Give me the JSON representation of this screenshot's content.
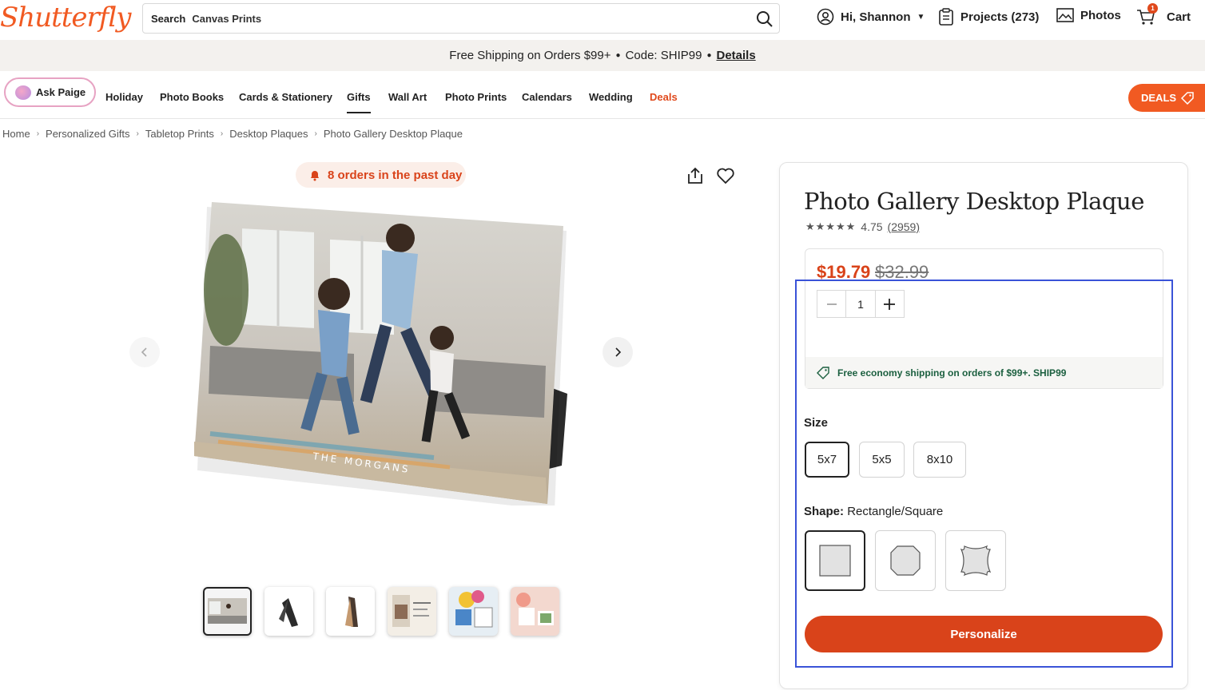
{
  "header": {
    "logo": "Shutterfly",
    "search_label": "Search",
    "search_value": "Canvas Prints",
    "greeting": "Hi, Shannon",
    "projects": "Projects (273)",
    "photos": "Photos",
    "cart": "Cart",
    "cart_badge": "1"
  },
  "promo": {
    "text": "Free Shipping on Orders $99+",
    "code": "Code: SHIP99",
    "details": "Details"
  },
  "nav": {
    "ask": "Ask Paige",
    "items": [
      "Holiday",
      "Photo Books",
      "Cards & Stationery",
      "Gifts",
      "Wall Art",
      "Photo Prints",
      "Calendars",
      "Wedding",
      "Deals"
    ],
    "deals_button": "DEALS"
  },
  "breadcrumb": [
    "Home",
    "Personalized Gifts",
    "Tabletop Prints",
    "Desktop Plaques",
    "Photo Gallery Desktop Plaque"
  ],
  "gallery": {
    "orders_badge": "8 orders in the past day",
    "caption": "THE MORGANS"
  },
  "product": {
    "title": "Photo Gallery Desktop Plaque",
    "stars": "★★★★★",
    "rating": "4.75",
    "reviews": "(2959)",
    "price_now": "$19.79",
    "price_was": "$32.99",
    "quantity": "1",
    "shipping_note": "Free economy shipping on orders of $99+. SHIP99",
    "size_label": "Size",
    "sizes": [
      "5x7",
      "5x5",
      "8x10"
    ],
    "shape_label": "Shape:",
    "shape_value": "Rectangle/Square",
    "personalize": "Personalize"
  },
  "colors": {
    "brand": "#f15a22",
    "price": "#d9431a",
    "focus": "#3a53d8"
  }
}
